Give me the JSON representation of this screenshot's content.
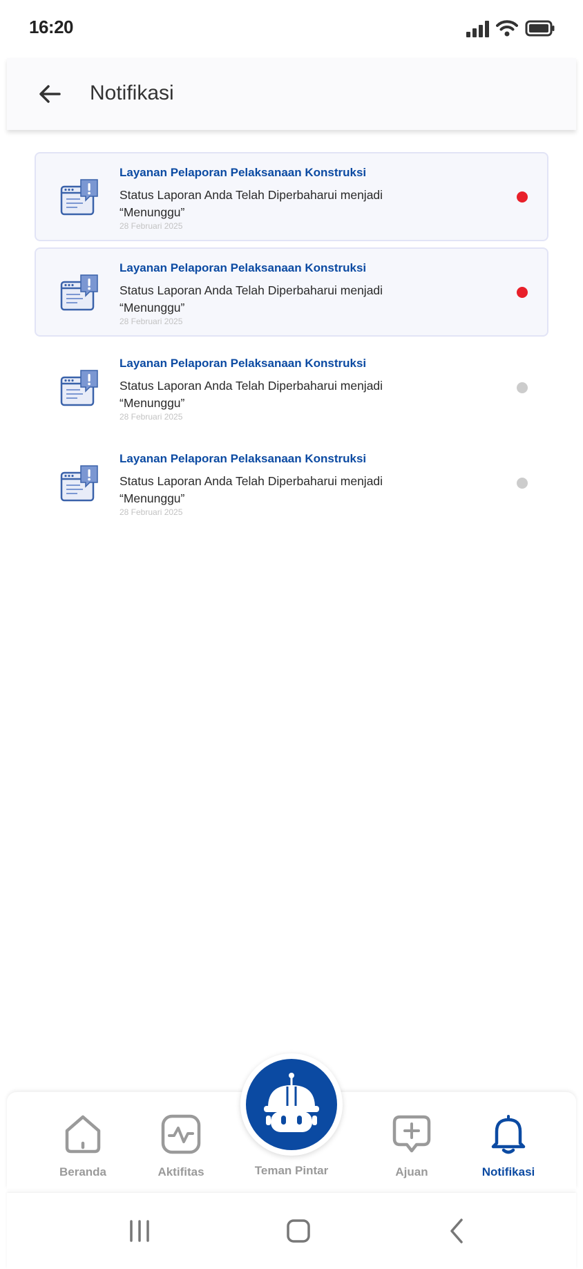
{
  "status_bar": {
    "time": "16:20"
  },
  "header": {
    "title": "Notifikasi"
  },
  "notifications": [
    {
      "title": "Layanan Pelaporan Pelaksanaan Konstruksi",
      "message": "Status Laporan Anda Telah Diperbaharui menjadi “Menunggu”",
      "date": "28 Februari 2025",
      "unread": true
    },
    {
      "title": "Layanan Pelaporan Pelaksanaan Konstruksi",
      "message": "Status Laporan Anda Telah Diperbaharui menjadi “Menunggu”",
      "date": "28 Februari 2025",
      "unread": true
    },
    {
      "title": "Layanan Pelaporan Pelaksanaan Konstruksi",
      "message": "Status Laporan Anda Telah Diperbaharui menjadi “Menunggu”",
      "date": "28 Februari 2025",
      "unread": false
    },
    {
      "title": "Layanan Pelaporan Pelaksanaan Konstruksi",
      "message": "Status Laporan Anda Telah Diperbaharui menjadi “Menunggu”",
      "date": "28 Februari 2025",
      "unread": false
    }
  ],
  "bottom_nav": {
    "items": [
      {
        "label": "Beranda",
        "icon": "home-icon"
      },
      {
        "label": "Aktifitas",
        "icon": "activity-icon"
      },
      {
        "label": "Teman Pintar",
        "icon": "robot-helmet-icon"
      },
      {
        "label": "Ajuan",
        "icon": "add-chat-icon"
      },
      {
        "label": "Notifikasi",
        "icon": "bell-icon",
        "active": true
      }
    ]
  },
  "colors": {
    "primary": "#0b4aa2",
    "unread_dot": "#e8202a",
    "read_dot": "#cccccc",
    "unread_bg": "#f6f7fc"
  }
}
